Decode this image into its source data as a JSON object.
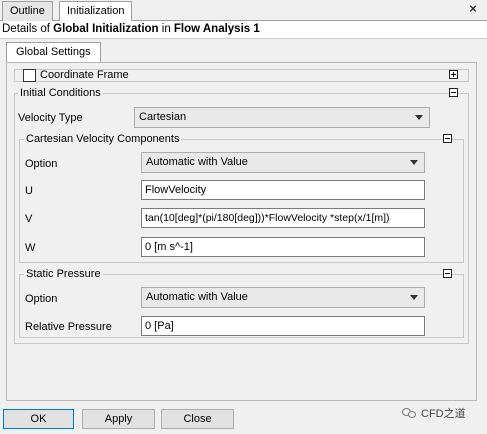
{
  "top_tabs": [
    {
      "label": "Outline",
      "active": false
    },
    {
      "label": "Initialization",
      "active": true
    }
  ],
  "close_icon": "×",
  "details": {
    "prefix": "Details of ",
    "object": "Global Initialization",
    "middle": " in ",
    "analysis": "Flow Analysis 1"
  },
  "sub_tab": "Global Settings",
  "coordinate_frame": {
    "label": "Coordinate Frame",
    "checked": false,
    "toggle": "expand"
  },
  "initial_conditions": {
    "label": "Initial Conditions",
    "toggle": "collapse",
    "velocity_type": {
      "label": "Velocity Type",
      "value": "Cartesian"
    },
    "cartesian": {
      "label": "Cartesian Velocity Components",
      "toggle": "collapse",
      "option": {
        "label": "Option",
        "value": "Automatic with Value"
      },
      "u": {
        "label": "U",
        "value": "FlowVelocity"
      },
      "v": {
        "label": "V",
        "value": "tan(10[deg]*(pi/180[deg]))*FlowVelocity *step(x/1[m])"
      },
      "w": {
        "label": "W",
        "value": "0 [m s^-1]"
      }
    },
    "static_pressure": {
      "label": "Static Pressure",
      "toggle": "collapse",
      "option": {
        "label": "Option",
        "value": "Automatic with Value"
      },
      "relative_pressure": {
        "label": "Relative Pressure",
        "value": "0 [Pa]"
      }
    }
  },
  "buttons": {
    "ok": "OK",
    "apply": "Apply",
    "close": "Close"
  },
  "watermark": "CFD之道"
}
